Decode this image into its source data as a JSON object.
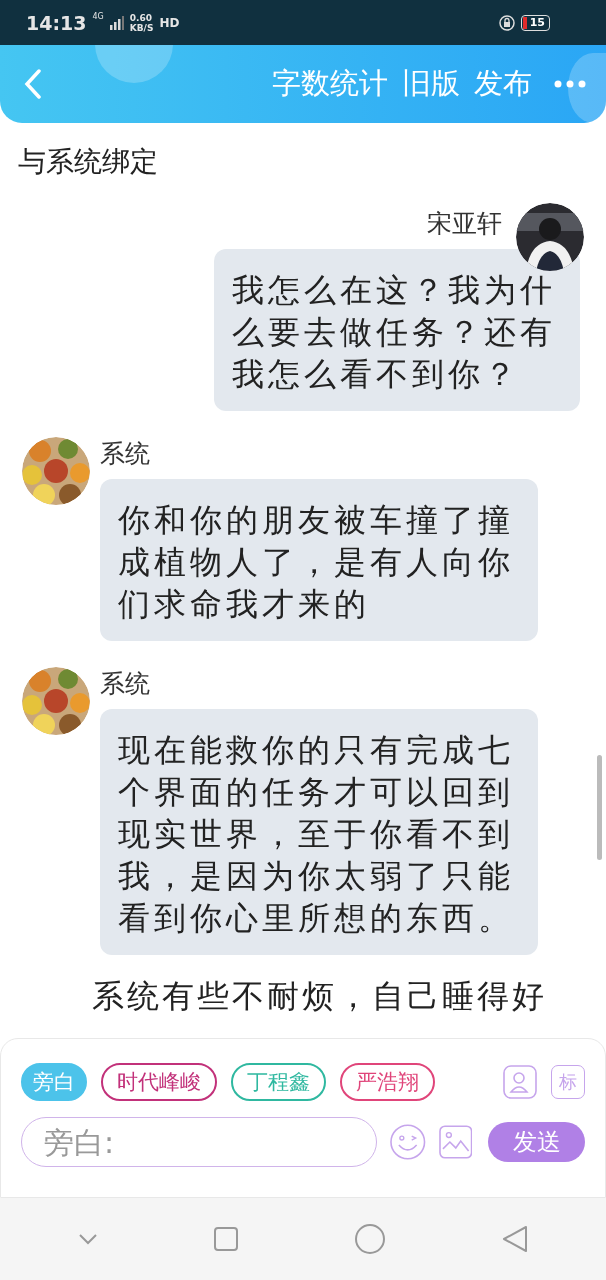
{
  "status_bar": {
    "time": "14:13",
    "network": "4G",
    "speed": "0.60",
    "speed_unit": "KB/S",
    "hd": "HD",
    "battery": "15"
  },
  "header": {
    "actions": [
      "字数统计",
      "旧版",
      "发布"
    ]
  },
  "chapter_title": "与系统绑定",
  "messages": [
    {
      "kind": "self",
      "sender": "宋亚轩",
      "text": "我怎么在这？我为什么要去做任务？还有我怎么看不到你？"
    },
    {
      "kind": "other",
      "sender": "系统",
      "text": "你和你的朋友被车撞了撞成植物人了，是有人向你们求命我才来的"
    },
    {
      "kind": "other",
      "sender": "系统",
      "text": "现在能救你的只有完成七个界面的任务才可以回到现实世界，至于你看不到我，是因为你太弱了只能看到你心里所想的东西。"
    },
    {
      "kind": "narration",
      "text": "系统有些不耐烦，自己睡得好"
    }
  ],
  "roles": [
    {
      "label": "旁白",
      "selected": true,
      "color": "#4cc3ea"
    },
    {
      "label": "时代峰峻",
      "selected": false,
      "color": "#c2317a"
    },
    {
      "label": "丁程鑫",
      "selected": false,
      "color": "#2fb8a0"
    },
    {
      "label": "严浩翔",
      "selected": false,
      "color": "#e0457a"
    }
  ],
  "composer": {
    "placeholder": "旁白:",
    "send": "发送"
  },
  "side_buttons": [
    "标"
  ]
}
